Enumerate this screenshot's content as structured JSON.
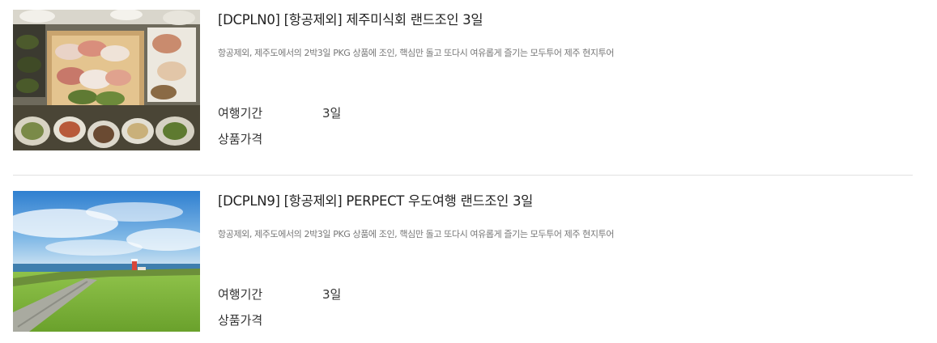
{
  "products": [
    {
      "title": "[DCPLN0] [항공제외] 제주미식회 랜드조인 3일",
      "description": "항공제외, 제주도에서의 2박3일 PKG 상품에 조인, 핵심만 돌고 또다시 여유롭게 즐기는 모두투어 제주 현지투어",
      "period_label": "여행기간",
      "period_value": "3일",
      "price_label": "상품가격",
      "price_value": "",
      "image": "jeju-seafood-table-photo"
    },
    {
      "title": "[DCPLN9] [항공제외] PERPECT 우도여행 랜드조인 3일",
      "description": "항공제외, 제주도에서의 2박3일 PKG 상품에 조인, 핵심만 돌고 또다시 여유롭게 즐기는 모두투어 제주 현지투어",
      "period_label": "여행기간",
      "period_value": "3일",
      "price_label": "상품가격",
      "price_value": "",
      "image": "udo-coast-lighthouse-photo"
    }
  ]
}
